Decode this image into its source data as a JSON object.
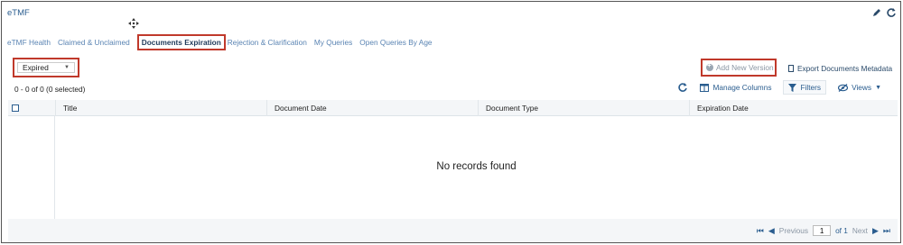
{
  "app": {
    "title": "eTMF"
  },
  "tabs": [
    {
      "label": "eTMF Health"
    },
    {
      "label": "Claimed & Unclaimed"
    },
    {
      "label": "Documents Expiration"
    },
    {
      "label": "Rejection & Clarification"
    },
    {
      "label": "My Queries"
    },
    {
      "label": "Open Queries By Age"
    }
  ],
  "filter": {
    "selected": "Expired"
  },
  "actions": {
    "add_version": "Add New Version",
    "export": "Export Documents Metadata"
  },
  "grid": {
    "count_text": "0 - 0 of 0 (0 selected)",
    "manage_columns": "Manage Columns",
    "filters": "Filters",
    "views": "Views",
    "columns": [
      "Title",
      "Document Date",
      "Document Type",
      "Expiration Date"
    ],
    "empty_text": "No records found"
  },
  "pager": {
    "previous": "Previous",
    "page": "1",
    "of_label": "of 1",
    "next": "Next"
  },
  "colors": {
    "accent": "#2a5d8f",
    "highlight": "#c0392b",
    "header_bg": "#f4f6f8"
  }
}
